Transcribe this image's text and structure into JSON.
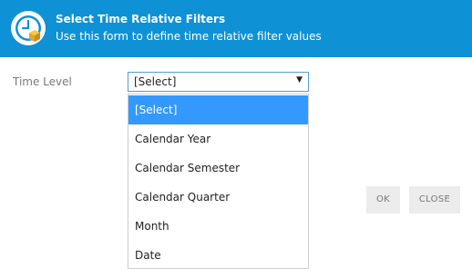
{
  "header": {
    "title": "Select Time Relative Filters",
    "subtitle": "Use this form to define time relative filter values",
    "icon": "clock-box-icon",
    "bg_color": "#0f91d6"
  },
  "form": {
    "time_level_label": "Time Level",
    "time_level_value": "[Select]"
  },
  "dropdown": {
    "options": [
      "[Select]",
      "Calendar Year",
      "Calendar Semester",
      "Calendar Quarter",
      "Month",
      "Date"
    ],
    "selected": "[Select]",
    "highlight_color": "#3399ff"
  },
  "buttons": {
    "ok": "OK",
    "close": "CLOSE"
  }
}
